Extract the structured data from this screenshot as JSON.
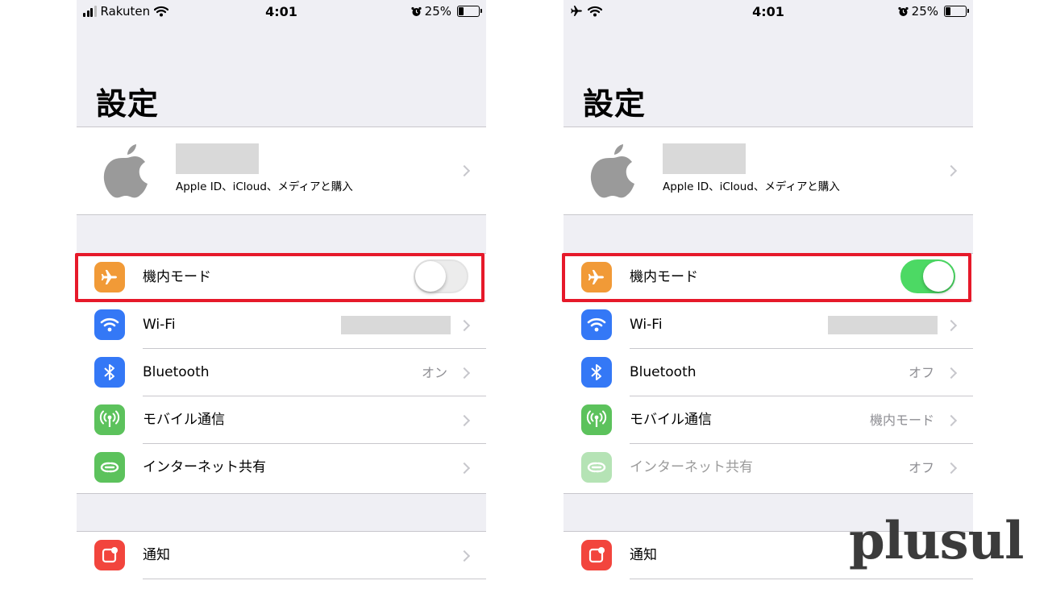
{
  "left_screen": {
    "status": {
      "carrier": "Rakuten",
      "time": "4:01",
      "battery": "25%"
    },
    "title": "設定",
    "apple_id": {
      "subtitle": "Apple ID、iCloud、メディアと購入"
    },
    "rows": [
      {
        "label": "機内モード",
        "toggle": "off"
      },
      {
        "label": "Wi-Fi",
        "value": ""
      },
      {
        "label": "Bluetooth",
        "value": "オン"
      },
      {
        "label": "モバイル通信",
        "value": ""
      },
      {
        "label": "インターネット共有",
        "value": ""
      }
    ],
    "notification_row": {
      "label": "通知"
    }
  },
  "right_screen": {
    "status": {
      "time": "4:01",
      "battery": "25%"
    },
    "title": "設定",
    "apple_id": {
      "subtitle": "Apple ID、iCloud、メディアと購入"
    },
    "rows": [
      {
        "label": "機内モード",
        "toggle": "on"
      },
      {
        "label": "Wi-Fi",
        "value": ""
      },
      {
        "label": "Bluetooth",
        "value": "オフ"
      },
      {
        "label": "モバイル通信",
        "value": "機内モード"
      },
      {
        "label": "インターネット共有",
        "value": "オフ"
      }
    ],
    "notification_row": {
      "label": "通知"
    }
  },
  "colors": {
    "airplane": "#f19a37",
    "wifi": "#3478f6",
    "bluetooth": "#3478f6",
    "cellular": "#5cc25c",
    "hotspot": "#5cc25c",
    "notifications": "#f2453d",
    "toggle_on": "#4cd964",
    "highlight": "#e6192a"
  },
  "watermark": "plusul"
}
